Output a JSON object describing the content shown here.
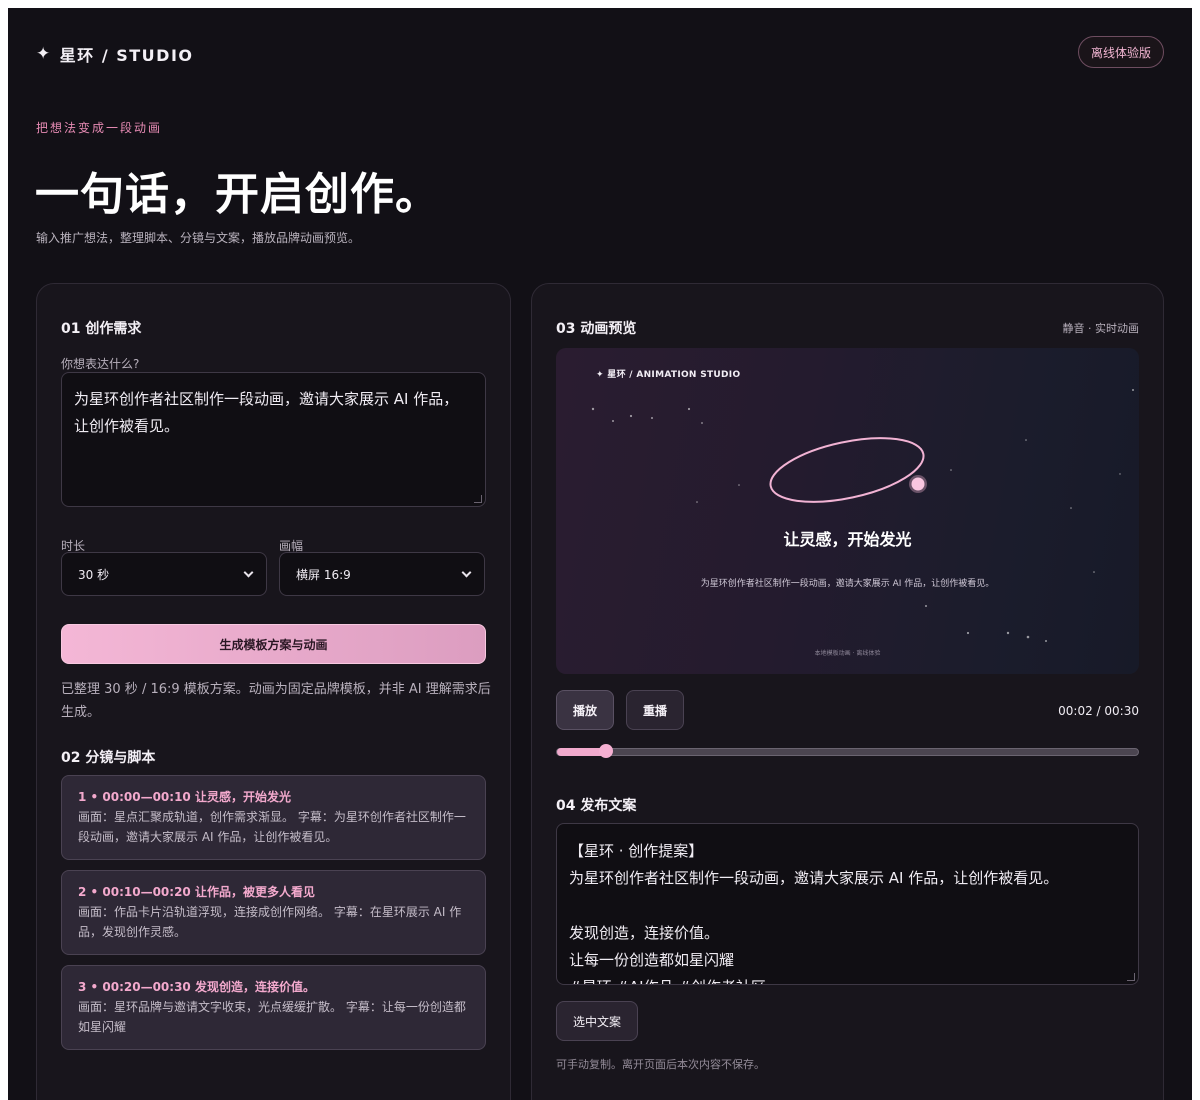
{
  "header": {
    "brand": "星环 / STUDIO",
    "badge": "离线体验版",
    "eyebrow": "把想法变成一段动画",
    "title": "一句话，开启创作。",
    "subtitle": "输入推广想法，整理脚本、分镜与文案，播放品牌动画预览。"
  },
  "request": {
    "heading": "01 创作需求",
    "prompt_label": "你想表达什么?",
    "prompt_value": "为星环创作者社区制作一段动画，邀请大家展示 AI 作品，让创作被看见。",
    "duration_label": "时长",
    "duration_value": "30 秒",
    "ratio_label": "画幅",
    "ratio_value": "横屏 16:9",
    "generate_label": "生成模板方案与动画",
    "note": "已整理 30 秒 / 16:9 模板方案。动画为固定品牌模板，并非 AI 理解需求后生成。"
  },
  "script": {
    "heading": "02 分镜与脚本",
    "scenes": [
      {
        "title": "1 • 00:00—00:10 让灵感，开始发光",
        "desc": "画面：星点汇聚成轨道，创作需求渐显。 字幕：为星环创作者社区制作一段动画，邀请大家展示 AI 作品，让创作被看见。"
      },
      {
        "title": "2 • 00:10—00:20 让作品，被更多人看见",
        "desc": "画面：作品卡片沿轨道浮现，连接成创作网络。 字幕：在星环展示 AI 作品，发现创作灵感。"
      },
      {
        "title": "3 • 00:20—00:30 发现创造，连接价值。",
        "desc": "画面：星环品牌与邀请文字收束，光点缓缓扩散。 字幕：让每一份创造都如星闪耀"
      }
    ]
  },
  "preview": {
    "heading": "03 动画预览",
    "hint": "静音 · 实时动画",
    "stage_brand": "✦ 星环 / ANIMATION STUDIO",
    "stage_title": "让灵感，开始发光",
    "stage_text": "为星环创作者社区制作一段动画，邀请大家展示 AI 作品，让创作被看见。",
    "stage_foot": "本地模板动画 · 离线体验",
    "play_label": "播放",
    "replay_label": "重播",
    "time": "00:02 / 00:30",
    "progress": 0.085
  },
  "publish": {
    "heading": "04 发布文案",
    "lines": [
      "【星环 · 创作提案】",
      "为星环创作者社区制作一段动画，邀请大家展示 AI 作品，让创作被看见。",
      "",
      "发现创造，连接价值。",
      "让每一份创造都如星闪耀",
      "#星环 #AI作品 #创作者社区"
    ],
    "select_label": "选中文案",
    "footnote": "可手动复制。离开页面后本次内容不保存。"
  },
  "colors": {
    "background": "#121016",
    "card": "#18151c",
    "accent_pink": "#f1aacd",
    "accent_text": "#e58ab3"
  }
}
